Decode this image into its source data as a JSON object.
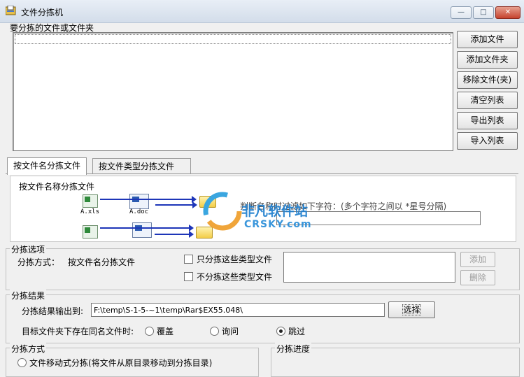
{
  "window": {
    "title": "文件分拣机",
    "min": "—",
    "max": "□",
    "close": "✕"
  },
  "files_section": {
    "label": "要分拣的文件或文件夹"
  },
  "side_buttons": [
    "添加文件",
    "添加文件夹",
    "移除文件(夹)",
    "清空列表",
    "导出列表",
    "导入列表"
  ],
  "tabs": [
    "按文件名分拣文件",
    "按文件类型分拣文件"
  ],
  "tab_panel": {
    "title": "按文件名称分拣文件",
    "diagram_labels": [
      "A.xls",
      "A.doc"
    ],
    "hint_partial": "判断名称时过滤如下字符：(多个字符之间以 *星号分隔)"
  },
  "watermark": {
    "name": "非凡软件站",
    "domain": "CRSKY.com"
  },
  "options": {
    "label": "分拣选项",
    "method_label": "分拣方式：",
    "method_value": "按文件名分拣文件",
    "only_types": "只分拣这些类型文件",
    "exclude_types": "不分拣这些类型文件",
    "add": "添加",
    "delete": "删除"
  },
  "result": {
    "label": "分拣结果",
    "output_label": "分拣结果输出到:",
    "output_path": "F:\\temp\\S-1-5-~1\\temp\\Rar$EX55.048\\",
    "choose": "选择",
    "exists_label": "目标文件夹下存在同名文件时:",
    "exists_options": [
      "覆盖",
      "询问",
      "跳过"
    ],
    "exists_selected": "跳过"
  },
  "mode": {
    "label": "分拣方式",
    "first_option_partial": "文件移动式分拣(将文件从原目录移动到分拣目录)"
  },
  "progress": {
    "label": "分拣进度"
  }
}
